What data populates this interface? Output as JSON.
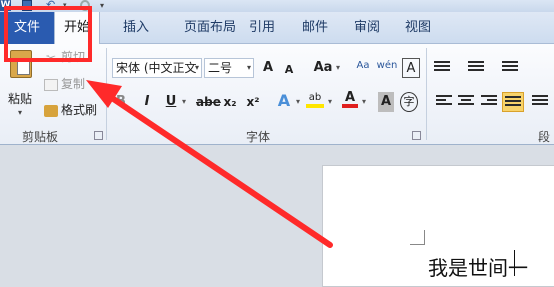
{
  "quick_access": {
    "word_icon": "W",
    "undo_arrow": "▾",
    "more": "▾"
  },
  "tabs": [
    "文件",
    "开始",
    "插入",
    "页面布局",
    "引用",
    "邮件",
    "审阅",
    "视图"
  ],
  "clipboard": {
    "paste": "粘贴",
    "cut": "剪切",
    "copy": "复制",
    "format_painter": "格式刷",
    "group_label": "剪贴板"
  },
  "font": {
    "font_name": "宋体 (中文正文",
    "font_size": "二号",
    "grow": "A",
    "shrink": "A",
    "change_case": "Aa",
    "clear_format": "Aa",
    "phonetic": "wén",
    "char_border": "A",
    "bold": "B",
    "italic": "I",
    "underline": "U",
    "strike": "abe",
    "subscript": "x₂",
    "superscript": "x²",
    "text_effect": "A",
    "highlight": "ab",
    "font_color": "A",
    "char_shading": "A",
    "enclose": "字",
    "group_label": "字体"
  },
  "paragraph": {
    "group_label": "段落"
  },
  "document": {
    "text": "我是世间一"
  },
  "colors": {
    "file_tab": "#2a5bb0",
    "annotation": "#ff2a2a",
    "font_color_bar": "#e02020",
    "highlight_bar": "#ffe600"
  }
}
